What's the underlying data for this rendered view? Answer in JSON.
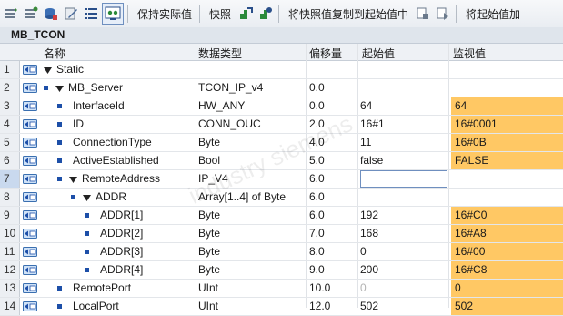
{
  "toolbar": {
    "keep_actual_label": "保持实际值",
    "snapshot_label": "快照",
    "copy_snapshot_label": "将快照值复制到起始值中",
    "load_start_label": "将起始值加"
  },
  "block_title": "MB_TCON",
  "columns": {
    "name": "名称",
    "type": "数据类型",
    "offset": "偏移量",
    "start": "起始值",
    "monitor": "监视值"
  },
  "rows": [
    {
      "n": "1",
      "name": "Static",
      "type": "",
      "offset": "",
      "start": "",
      "monitor": ""
    },
    {
      "n": "2",
      "name": "MB_Server",
      "type": "TCON_IP_v4",
      "offset": "0.0",
      "start": "",
      "monitor": ""
    },
    {
      "n": "3",
      "name": "InterfaceId",
      "type": "HW_ANY",
      "offset": "0.0",
      "start": "64",
      "monitor": "64"
    },
    {
      "n": "4",
      "name": "ID",
      "type": "CONN_OUC",
      "offset": "2.0",
      "start": "16#1",
      "monitor": "16#0001"
    },
    {
      "n": "5",
      "name": "ConnectionType",
      "type": "Byte",
      "offset": "4.0",
      "start": "11",
      "monitor": "16#0B"
    },
    {
      "n": "6",
      "name": "ActiveEstablished",
      "type": "Bool",
      "offset": "5.0",
      "start": "false",
      "monitor": "FALSE"
    },
    {
      "n": "7",
      "name": "RemoteAddress",
      "type": "IP_V4",
      "offset": "6.0",
      "start": "",
      "monitor": ""
    },
    {
      "n": "8",
      "name": "ADDR",
      "type": "Array[1..4] of Byte",
      "offset": "6.0",
      "start": "",
      "monitor": ""
    },
    {
      "n": "9",
      "name": "ADDR[1]",
      "type": "Byte",
      "offset": "6.0",
      "start": "192",
      "monitor": "16#C0"
    },
    {
      "n": "10",
      "name": "ADDR[2]",
      "type": "Byte",
      "offset": "7.0",
      "start": "168",
      "monitor": "16#A8"
    },
    {
      "n": "11",
      "name": "ADDR[3]",
      "type": "Byte",
      "offset": "8.0",
      "start": "0",
      "monitor": "16#00"
    },
    {
      "n": "12",
      "name": "ADDR[4]",
      "type": "Byte",
      "offset": "9.0",
      "start": "200",
      "monitor": "16#C8"
    },
    {
      "n": "13",
      "name": "RemotePort",
      "type": "UInt",
      "offset": "10.0",
      "start": "0",
      "monitor": "0"
    },
    {
      "n": "14",
      "name": "LocalPort",
      "type": "UInt",
      "offset": "12.0",
      "start": "502",
      "monitor": "502"
    }
  ],
  "colors": {
    "monitor_highlight": "#ffc864",
    "tree_blue": "#1d4fa8"
  }
}
